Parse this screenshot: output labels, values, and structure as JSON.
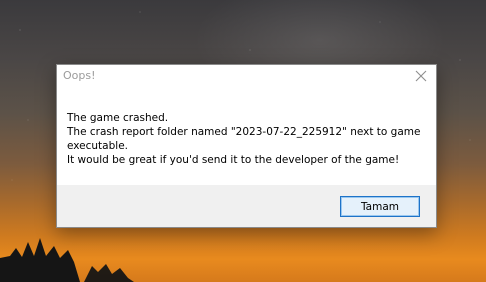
{
  "dialog": {
    "title": "Oops!",
    "message_lines": [
      "The game crashed.",
      "The crash report folder named \"2023-07-22_225912\" next to game executable.",
      "It would be great if you'd send it to the developer of the game!"
    ],
    "ok_button_label": "Tamam",
    "close_icon": "close-icon"
  },
  "colors": {
    "title_text": "#9b9b9b",
    "button_border": "#1e73c8",
    "button_fill": "#e5f1fb",
    "footer_bg": "#f0f0f0"
  }
}
